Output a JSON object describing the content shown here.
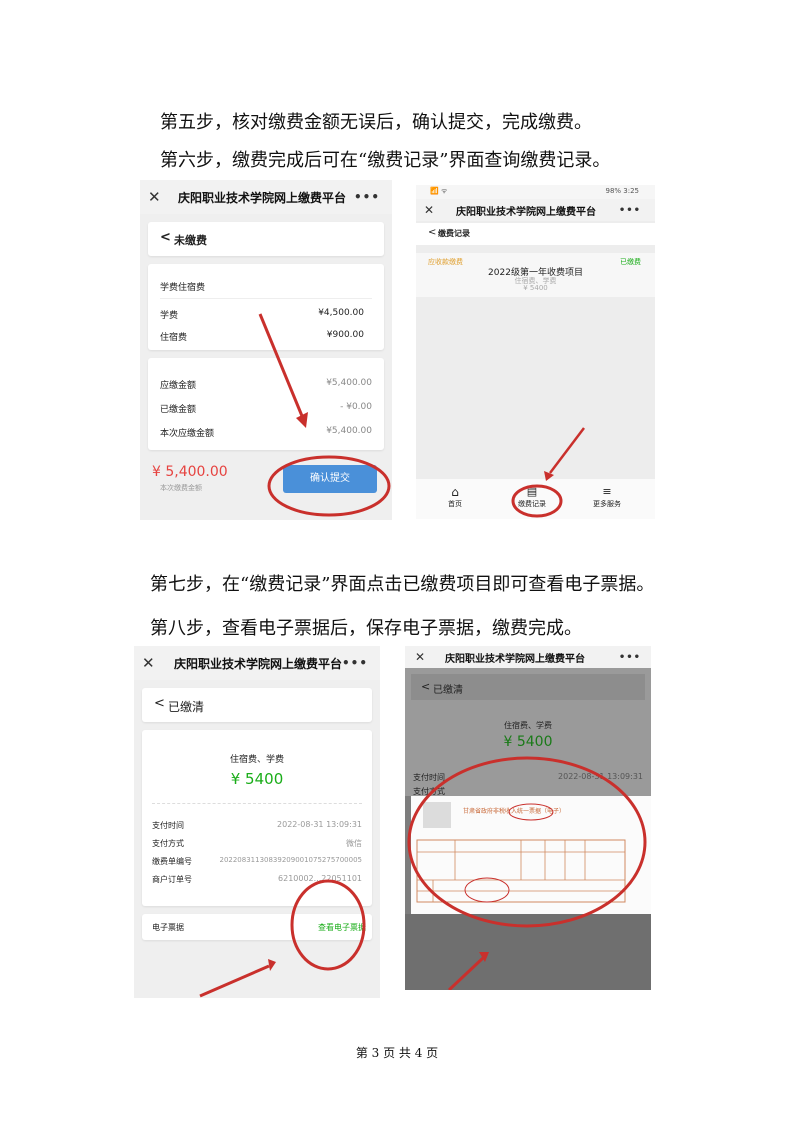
{
  "steps": {
    "step5": "第五步，核对缴费金额无误后，确认提交，完成缴费。",
    "step6": "第六步，缴费完成后可在“缴费记录”界面查询缴费记录。",
    "step7": "第七步，在“缴费记录”界面点击已缴费项目即可查看电子票据。",
    "step8": "第八步，查看电子票据后，保存电子票据，缴费完成。"
  },
  "app_title": "庆阳职业技术学院网上缴费平台",
  "shot1": {
    "back_label": "未缴费",
    "section": "学费住宿费",
    "items": [
      {
        "label": "学费",
        "value": "¥4,500.00"
      },
      {
        "label": "住宿费",
        "value": "¥900.00"
      }
    ],
    "summary": [
      {
        "label": "应缴金额",
        "value": "¥5,400.00"
      },
      {
        "label": "已缴金额",
        "value": "- ¥0.00"
      },
      {
        "label": "本次应缴金额",
        "value": "¥5,400.00"
      }
    ],
    "total": "¥ 5,400.00",
    "total_caption": "本次缴费金额",
    "submit_label": "确认提交"
  },
  "shot2": {
    "status_left": "📶 ᯤ",
    "status_right": "98% 3:25",
    "back_label": "缴费记录",
    "tag_left": "应收款缴费",
    "tag_right": "已缴费",
    "project_title": "2022级第一年收费项目",
    "project_sub": "住宿费、学费",
    "project_amount": "¥ 5400",
    "nav": [
      {
        "label": "首页"
      },
      {
        "label": "缴费记录"
      },
      {
        "label": "更多服务"
      }
    ]
  },
  "shot3": {
    "back_label": "已缴清",
    "items_name": "住宿费、学费",
    "amount": "¥ 5400",
    "details": [
      {
        "label": "支付时间",
        "value": "2022-08-31 13:09:31"
      },
      {
        "label": "支付方式",
        "value": "微信"
      },
      {
        "label": "缴费单编号",
        "value": "2022083113083920900107527570000​5"
      },
      {
        "label": "商户订单号",
        "value": "6210002...22051101"
      }
    ],
    "receipt_label": "电子票据",
    "receipt_link": "查看电子票据"
  },
  "shot4": {
    "back_label": "已缴清",
    "items_name": "住宿费、学费",
    "amount": "¥ 5400",
    "pay_time_label": "支付时间",
    "pay_time_value": "2022-08-31 13:09:31",
    "pay_method_label": "支付方式",
    "receipt_title": "甘肃省政府非税收入统一票据（电子）"
  },
  "footer": "第 3 页 共 4 页",
  "colors": {
    "red": "#c9302c",
    "blue": "#4a90d9",
    "green": "#1aad19",
    "amount_red": "#e64340"
  }
}
